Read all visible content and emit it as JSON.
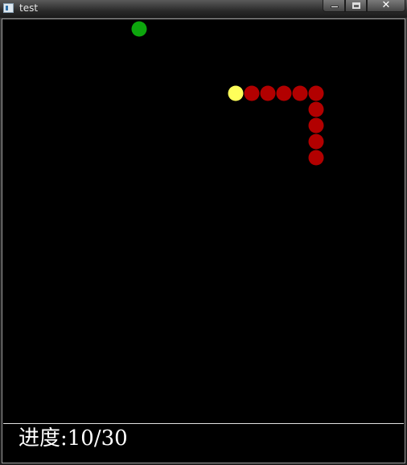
{
  "window": {
    "title": "test",
    "controls": {
      "minimize_icon": "minimize-icon",
      "maximize_icon": "maximize-icon",
      "close_icon": "close-icon",
      "close_label": "✕"
    }
  },
  "game": {
    "grid_cell_size": 20,
    "colors": {
      "background": "#000000",
      "food": "#0da60d",
      "snake_head": "#ffff5a",
      "snake_body": "#b20000"
    },
    "food": {
      "col": 8,
      "row": 0
    },
    "snake": [
      {
        "col": 14,
        "row": 4,
        "part": "head"
      },
      {
        "col": 15,
        "row": 4,
        "part": "body"
      },
      {
        "col": 16,
        "row": 4,
        "part": "body"
      },
      {
        "col": 17,
        "row": 4,
        "part": "body"
      },
      {
        "col": 18,
        "row": 4,
        "part": "body"
      },
      {
        "col": 19,
        "row": 4,
        "part": "body"
      },
      {
        "col": 19,
        "row": 5,
        "part": "body"
      },
      {
        "col": 19,
        "row": 6,
        "part": "body"
      },
      {
        "col": 19,
        "row": 7,
        "part": "body"
      },
      {
        "col": 19,
        "row": 8,
        "part": "body"
      }
    ]
  },
  "status": {
    "progress_text": "进度:10/30"
  }
}
